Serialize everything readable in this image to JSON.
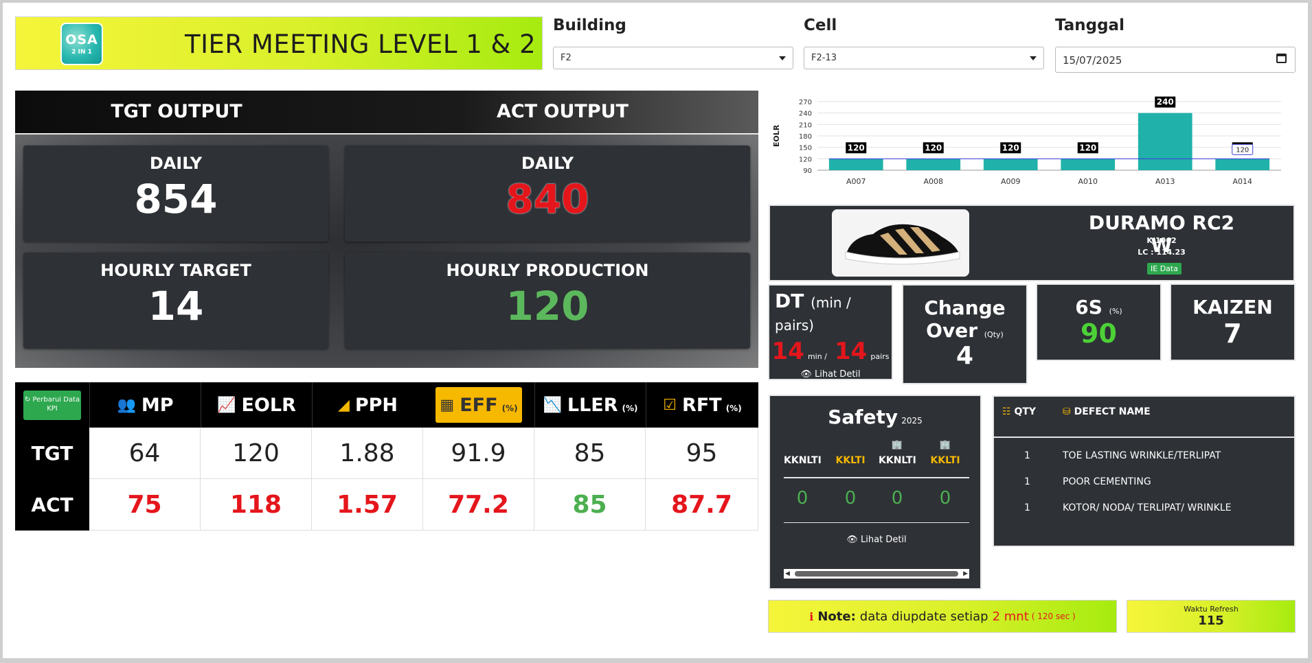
{
  "header": {
    "logo_line1": "OSA",
    "logo_line2": "2 IN 1",
    "title": "TIER MEETING LEVEL 1 & 2"
  },
  "filters": {
    "building_label": "Building",
    "building_value": "F2",
    "cell_label": "Cell",
    "cell_value": "F2-13",
    "date_label": "Tanggal",
    "date_value": "15/07/2025"
  },
  "output": {
    "tgt_header": "TGT OUTPUT",
    "act_header": "ACT OUTPUT",
    "tgt_daily_label": "DAILY",
    "tgt_daily_value": "854",
    "act_daily_label": "DAILY",
    "act_daily_value": "840",
    "hourly_target_label": "HOURLY TARGET",
    "hourly_target_value": "14",
    "hourly_production_label": "HOURLY PRODUCTION",
    "hourly_production_value": "120",
    "colors": {
      "red": "#e4161c",
      "green": "#4caf50"
    }
  },
  "kpi": {
    "refresh_button": "Perbarui Data KPI",
    "columns": [
      {
        "label": "MP",
        "icon": "users-icon",
        "unit": ""
      },
      {
        "label": "EOLR",
        "icon": "line-chart-icon",
        "unit": ""
      },
      {
        "label": "PPH",
        "icon": "bar-chart-icon",
        "unit": ""
      },
      {
        "label": "EFF",
        "icon": "table-icon",
        "unit": "(%)"
      },
      {
        "label": "LLER",
        "icon": "area-chart-icon",
        "unit": "(%)"
      },
      {
        "label": "RFT",
        "icon": "check-square-icon",
        "unit": "(%)"
      }
    ],
    "rows": [
      {
        "label": "TGT",
        "values": [
          "64",
          "120",
          "1.88",
          "91.9",
          "85",
          "95"
        ],
        "status": [
          "normal",
          "normal",
          "normal",
          "normal",
          "normal",
          "normal"
        ]
      },
      {
        "label": "ACT",
        "values": [
          "75",
          "118",
          "1.57",
          "77.2",
          "85",
          "87.7"
        ],
        "status": [
          "red",
          "red",
          "red",
          "red",
          "green",
          "red"
        ]
      }
    ]
  },
  "chart_data": {
    "type": "bar",
    "ylabel": "EOLR",
    "categories": [
      "A007",
      "A008",
      "A009",
      "A010",
      "A013",
      "A014"
    ],
    "values": [
      120,
      120,
      120,
      120,
      240,
      120
    ],
    "target_line": 120,
    "target_label": "120",
    "yticks": [
      90,
      120,
      150,
      180,
      210,
      240,
      270
    ],
    "ylim": [
      90,
      270
    ],
    "bar_color": "#20b2aa",
    "line_color": "#3b3bd6"
  },
  "product": {
    "name": "DURAMO RC2 W",
    "code": "KJ1062",
    "lc": "LC : 114.23",
    "badge": "IE Data"
  },
  "cards": {
    "dt_title": "DT",
    "dt_unit": "(min / pairs)",
    "dt_min": "14",
    "dt_min_unit": "min /",
    "dt_pairs": "14",
    "dt_pairs_unit": "pairs",
    "dt_link": "Lihat Detil",
    "change_title1": "Change",
    "change_title2": "Over",
    "change_unit": "(Qty)",
    "change_value": "4",
    "six_s_title": "6S",
    "six_s_unit": "(%)",
    "six_s_value": "90",
    "kaizen_title": "KAIZEN",
    "kaizen_value": "7"
  },
  "safety": {
    "title": "Safety",
    "year": "2025",
    "cols": [
      "KKNLTI",
      "KKLTI",
      "KKNLTI",
      "KKLTI"
    ],
    "values": [
      "0",
      "0",
      "0",
      "0"
    ],
    "link": "Lihat Detil"
  },
  "defects": {
    "qty_header": "QTY",
    "name_header": "DEFECT NAME",
    "rows": [
      {
        "qty": "1",
        "name": "TOE LASTING WRINKLE/TERLIPAT"
      },
      {
        "qty": "1",
        "name": "POOR CEMENTING"
      },
      {
        "qty": "1",
        "name": "KOTOR/ NODA/ TERLIPAT/ WRINKLE"
      }
    ]
  },
  "note": {
    "label": "Note:",
    "text": "data diupdate setiap",
    "interval": "2 mnt",
    "seconds": "( 120 sec )"
  },
  "refresh": {
    "label": "Waktu Refresh",
    "value": "115"
  }
}
